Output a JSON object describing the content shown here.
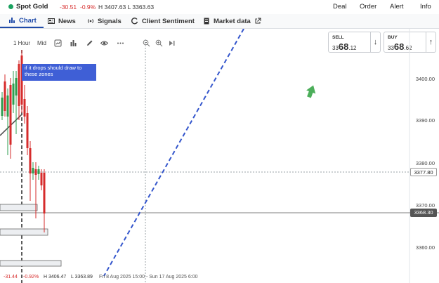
{
  "header": {
    "instrument": "Spot Gold",
    "status_color": "#1ba260",
    "change": "-30.51",
    "change_pct": "-0.9%",
    "high_low": "H 3407.63 L 3363.63",
    "nav": [
      "Deal",
      "Order",
      "Alert",
      "Info"
    ]
  },
  "tabs": [
    {
      "label": "Chart",
      "icon": "chart-icon"
    },
    {
      "label": "News",
      "icon": "news-icon"
    },
    {
      "label": "Signals",
      "icon": "signals-icon"
    },
    {
      "label": "Client Sentiment",
      "icon": "sentiment-icon"
    },
    {
      "label": "Market data",
      "icon": "market-data-icon"
    }
  ],
  "toolbar": {
    "timeframe": "1 Hour",
    "price_type": "Mid"
  },
  "sell": {
    "label": "SELL",
    "prefix": "33",
    "big": "68",
    "suffix": ".12"
  },
  "buy": {
    "label": "BUY",
    "prefix": "33",
    "big": "68",
    "suffix": ".62"
  },
  "annotation": "if it drops should draw to these zones",
  "price_axis": {
    "ticks": [
      "3400.00",
      "3390.00",
      "3380.00",
      "3370.00",
      "3360.00"
    ],
    "marker_1": "3377.80",
    "marker_2": "3368.30"
  },
  "footer": {
    "change": "-31.44",
    "change_pct": "-0.92%",
    "high": "H 3406.47",
    "low": "L 3363.89",
    "date_range": "Fri 8 Aug 2025 15:00 - Sun 17 Aug 2025 6:00"
  },
  "colors": {
    "bull": "#2e9e4f",
    "bear": "#d62b2b",
    "accent": "#1f4aa8",
    "trendline": "#3355cc",
    "annotation_bg": "#3f5fd6",
    "negative": "#d62b2b"
  }
}
